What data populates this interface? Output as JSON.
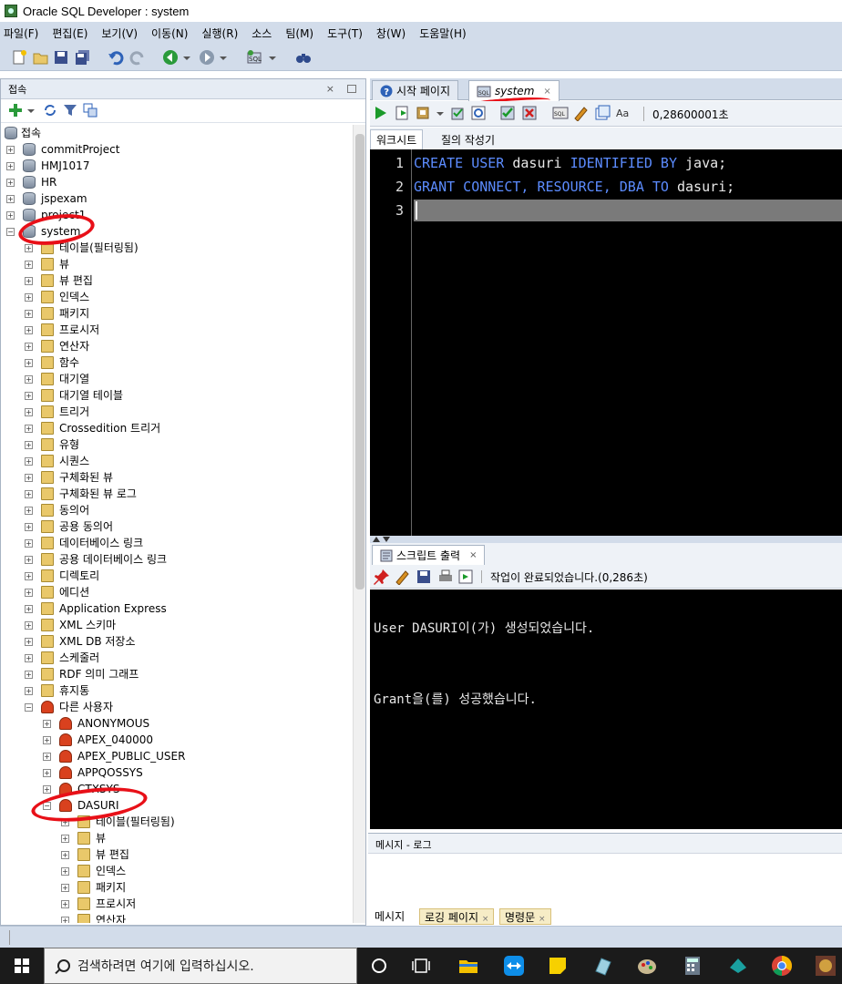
{
  "window": {
    "title": "Oracle SQL Developer : system"
  },
  "menu": [
    "파일(F)",
    "편집(E)",
    "보기(V)",
    "이동(N)",
    "실행(R)",
    "소스",
    "팀(M)",
    "도구(T)",
    "창(W)",
    "도움말(H)"
  ],
  "toolbar_icons": [
    "new-icon",
    "open-icon",
    "save-icon",
    "save-all-icon",
    "undo-icon",
    "redo-icon",
    "back-icon",
    "forward-icon",
    "sql-worksheet-icon",
    "binoculars-icon"
  ],
  "connections_panel": {
    "title": "접속",
    "close": "×",
    "connections": [
      {
        "label": "commitProject",
        "icon": "db-icon"
      },
      {
        "label": "HMJ1017",
        "icon": "db-icon"
      },
      {
        "label": "HR",
        "icon": "db-icon"
      },
      {
        "label": "jspexam",
        "icon": "db-icon"
      },
      {
        "label": "project1",
        "icon": "db-icon"
      },
      {
        "label": "system",
        "icon": "db-icon"
      }
    ],
    "system_children": [
      "테이블(필터링됨)",
      "뷰",
      "뷰 편집",
      "인덱스",
      "패키지",
      "프로시저",
      "연산자",
      "함수",
      "대기열",
      "대기열 테이블",
      "트리거",
      "Crossedition 트리거",
      "유형",
      "시퀀스",
      "구체화된 뷰",
      "구체화된 뷰 로그",
      "동의어",
      "공용 동의어",
      "데이터베이스 링크",
      "공용 데이터베이스 링크",
      "디렉토리",
      "에디션",
      "Application Express",
      "XML 스키마",
      "XML DB 저장소",
      "스케줄러",
      "RDF 의미 그래프",
      "휴지통",
      "다른 사용자"
    ],
    "other_users": [
      "ANONYMOUS",
      "APEX_040000",
      "APEX_PUBLIC_USER",
      "APPQOSSYS",
      "CTXSYS",
      "DASURI"
    ],
    "dasuri_children": [
      "테이블(필터링됨)",
      "뷰",
      "뷰 편집",
      "인덱스",
      "패키지",
      "프로시저",
      "연산자"
    ]
  },
  "editor_tabs": [
    {
      "label": "시작 페이지",
      "icon": "help-icon"
    },
    {
      "label": "system",
      "icon": "sql-icon",
      "close": "×"
    }
  ],
  "editor_toolbar": {
    "timing": "0,28600001초"
  },
  "editor_subtabs": [
    "워크시트",
    "질의 작성기"
  ],
  "editor": {
    "lines": [
      {
        "num": "1",
        "text": "CREATE USER dasuri IDENTIFIED BY java;"
      },
      {
        "num": "2",
        "text": "GRANT CONNECT, RESOURCE, DBA TO dasuri;"
      },
      {
        "num": "3",
        "text": ""
      }
    ]
  },
  "script_output": {
    "tab_label": "스크립트 출력",
    "close": "×",
    "status": "작업이 완료되었습니다.(0,286초)",
    "lines": [
      "User DASURI이(가) 생성되었습니다.",
      "Grant을(를) 성공했습니다."
    ]
  },
  "message_log": {
    "title": "메시지 - 로그",
    "tabs": [
      "메시지",
      "로깅 페이지",
      "명령문"
    ],
    "close": "×"
  },
  "taskbar": {
    "search_placeholder": "검색하려면 여기에 입력하십시오.",
    "apps": [
      "cortana-icon",
      "task-view-icon",
      "file-explorer-icon",
      "teamviewer-icon",
      "sticky-notes-icon",
      "app-icon",
      "paint-icon",
      "calculator-icon",
      "app2-icon",
      "chrome-icon",
      "game-icon"
    ]
  }
}
